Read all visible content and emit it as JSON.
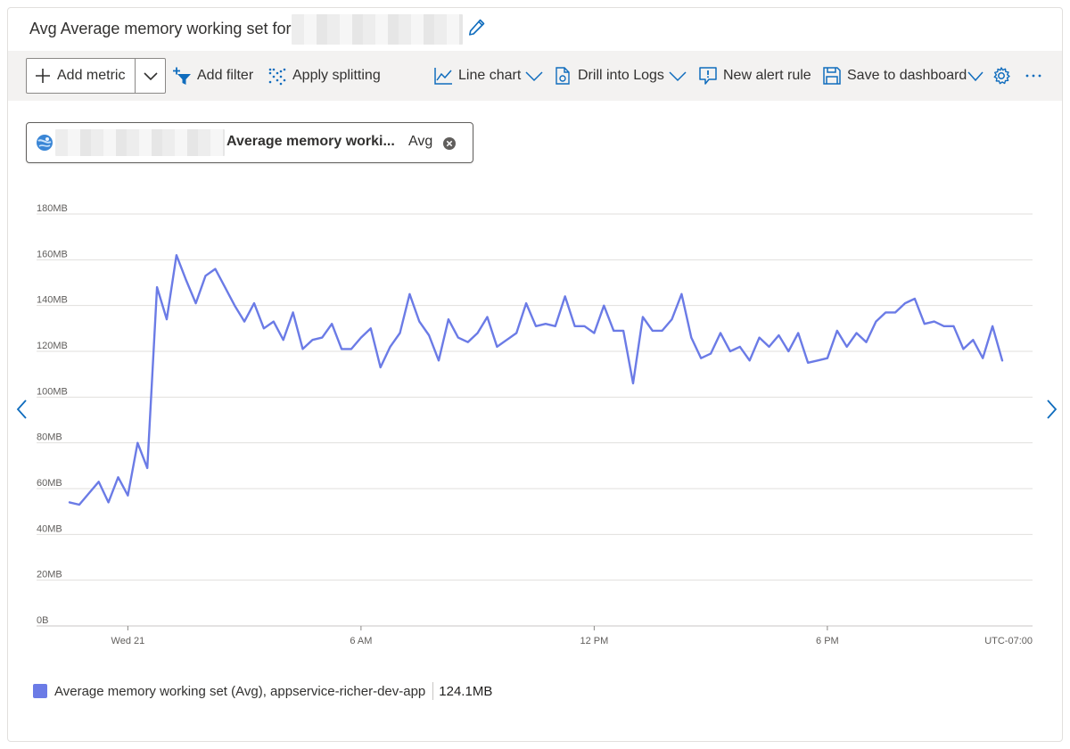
{
  "title": {
    "prefix": "Avg Average memory working set for"
  },
  "toolbar": {
    "add_metric": "Add metric",
    "add_filter": "Add filter",
    "apply_splitting": "Apply splitting",
    "line_chart": "Line chart",
    "drill_into_logs": "Drill into Logs",
    "new_alert_rule": "New alert rule",
    "save_to_dashboard": "Save to dashboard"
  },
  "metric_pill": {
    "metric": "Average memory worki...",
    "aggregation": "Avg"
  },
  "colors": {
    "accent": "#0f6cbd",
    "series": "#6b7be6",
    "grid": "#e1dfdd"
  },
  "chart_data": {
    "type": "line",
    "y_ticks": [
      "180MB",
      "160MB",
      "140MB",
      "120MB",
      "100MB",
      "80MB",
      "60MB",
      "40MB",
      "20MB",
      "0B"
    ],
    "ylim": [
      0,
      180
    ],
    "x_ticks": [
      {
        "label": "Wed 21",
        "at": "00:00"
      },
      {
        "label": "6 AM",
        "at": "06:00"
      },
      {
        "label": "12 PM",
        "at": "12:00"
      },
      {
        "label": "6 PM",
        "at": "18:00"
      }
    ],
    "timezone": "UTC-07:00",
    "x_start": "22:30",
    "x_step_minutes": 15,
    "series": [
      {
        "name": "Average memory working set (Avg), appservice-richer-dev-app",
        "summary": "124.1MB",
        "color": "#6b7be6",
        "values": [
          54,
          53,
          58,
          63,
          54,
          65,
          57,
          80,
          69,
          148,
          134,
          162,
          151,
          141,
          153,
          156,
          148,
          140,
          133,
          141,
          130,
          133,
          125,
          137,
          121,
          125,
          126,
          132,
          121,
          121,
          126,
          130,
          113,
          122,
          128,
          145,
          133,
          127,
          116,
          134,
          126,
          124,
          128,
          135,
          122,
          125,
          128,
          141,
          131,
          132,
          131,
          144,
          131,
          131,
          128,
          140,
          129,
          129,
          106,
          135,
          129,
          129,
          134,
          145,
          126,
          117,
          119,
          128,
          120,
          122,
          116,
          126,
          122,
          127,
          120,
          128,
          115,
          116,
          117,
          129,
          122,
          128,
          124,
          133,
          137,
          137,
          141,
          143,
          132,
          133,
          131,
          131,
          121,
          125,
          117,
          131,
          116
        ]
      }
    ]
  }
}
